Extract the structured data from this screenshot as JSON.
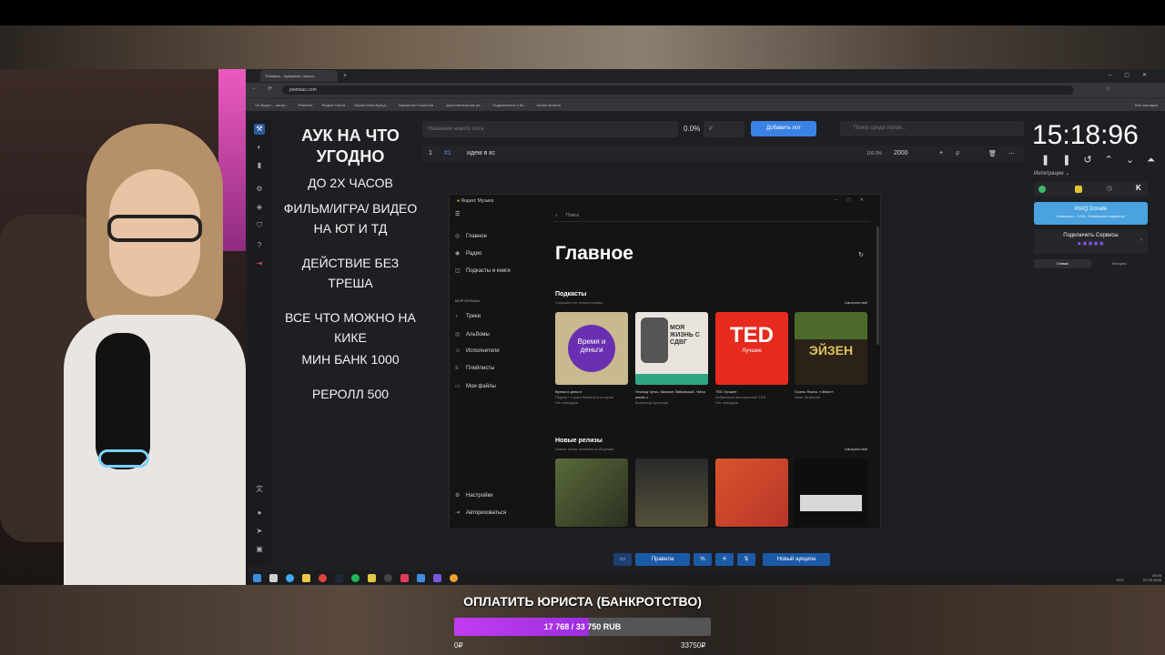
{
  "browser": {
    "tab_title": "Pointauc – Аукционы, голосо…",
    "url": "pointauc.com",
    "bookmarks": [
      "VK Видео – смотр…",
      "Pinterest",
      "Яндекс Почта",
      "Oplata Илья Бульд…",
      "Чарлинтен Гошко Ва…",
      "Дополнительные ре…",
      "Подключение к Бо…",
      "Adobe Acrobat"
    ],
    "all_bookmarks": "Все закладки"
  },
  "auction_text": {
    "line1": "АУК НА ЧТО УГОДНО",
    "line2": "ДО 2Х ЧАСОВ",
    "line3": "ФИЛЬМ/ИГРА/ ВИДЕО НА ЮТ И ТД",
    "line4": "ДЕЙСТВИЕ БЕЗ ТРЕША",
    "line5": "ВСЕ ЧТО МОЖНО НА КИКЕ",
    "line6": "МИН БАНК 1000",
    "line7": "РЕРОЛЛ 500"
  },
  "lot_form": {
    "name_placeholder": "Название нового лота",
    "percent": "0.0%",
    "amount_placeholder": "₽",
    "add_button": "Добавить лот",
    "search_placeholder": "Поиск среди лотов..."
  },
  "lots": [
    {
      "index": "1",
      "badge": "#1",
      "name": "идем в кс",
      "percent": "100.0%",
      "amount": "2000"
    }
  ],
  "timer": {
    "display": "15:18:96"
  },
  "integrations": {
    "label": "Интеграции",
    "donate_title": "IHAQ Donate",
    "donate_sub": "Комиссия – 3,5%. Уникальные виджеты!",
    "connect_services": "Подключить Сервисы",
    "tab_bets": "Ставки",
    "tab_history": "История"
  },
  "yandex_music": {
    "app_title": "Яндекс Музыка",
    "search_placeholder": "Поиск",
    "nav": [
      "Главное",
      "Радио",
      "Подкасты и книги"
    ],
    "my_music_label": "МОЯ МУЗЫКА",
    "my_music": [
      "Треки",
      "Альбомы",
      "Исполнители",
      "Плейлисты",
      "Мои файлы"
    ],
    "bottom_nav": [
      "Настройки",
      "Авторизоваться"
    ],
    "heading": "Главное",
    "podcasts": {
      "title": "Подкасты",
      "subtitle": "Слушайте не только музыку",
      "see_all": "Смотреть всё",
      "items": [
        {
          "cover_text": "Время и деньги",
          "title": "Время и деньги",
          "line2": "Подкаст о роли бизнеса в истории",
          "line3": "Нет эпизодов"
        },
        {
          "cover_text": "МОЯ ЖИЗНЬ С СДВГ",
          "title": "Леонид Чутко, Михаил Лабковский. «Моя жизнь с…",
          "line2": "Всеволод Кузнецов",
          "line3": ""
        },
        {
          "cover_text": "TED",
          "cover_sub": "Лучшее",
          "title": "TED Лучшее",
          "line2": "Избранные выступления TED",
          "line3": "Нет эпизодов"
        },
        {
          "cover_text": "ЭЙЗЕН",
          "title": "Гузель Яхина. «Эйзен»",
          "line2": "Иван Литвинов",
          "line3": ""
        }
      ]
    },
    "new_releases": {
      "title": "Новые релизы",
      "subtitle": "Новые треки, альбомы и сборники",
      "see_all": "Смотреть всё"
    }
  },
  "bottom_tools": {
    "rules": "Правила",
    "percent": "%",
    "new_auction": "Новый аукцион"
  },
  "taskbar": {
    "lang": "РУС",
    "time": "20:05",
    "date": "07.05.2026"
  },
  "donation_goal": {
    "title": "ОПЛАТИТЬ ЮРИСТА (БАНКРОТСТВО)",
    "progress_text": "17 768 / 33 750 RUB",
    "current": 17768,
    "target": 33750,
    "min_label": "0₽",
    "max_label": "33750₽",
    "fill_color": "#b335eb"
  }
}
